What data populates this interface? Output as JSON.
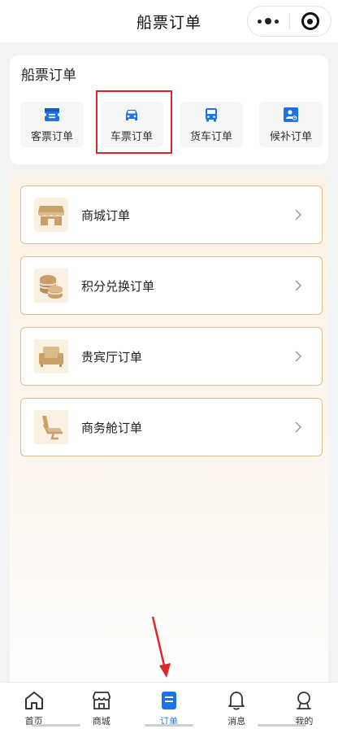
{
  "header": {
    "title": "船票订单"
  },
  "categories": {
    "title": "船票订单",
    "items": [
      {
        "label": "客票订单",
        "icon": "ticket-icon"
      },
      {
        "label": "车票订单",
        "icon": "car-icon"
      },
      {
        "label": "货车订单",
        "icon": "truck-icon"
      },
      {
        "label": "候补订单",
        "icon": "waitlist-icon"
      }
    ]
  },
  "orders": [
    {
      "label": "商城订单",
      "icon": "shop-icon"
    },
    {
      "label": "积分兑换订单",
      "icon": "coins-icon"
    },
    {
      "label": "贵宾厅订单",
      "icon": "sofa-icon"
    },
    {
      "label": "商务舱订单",
      "icon": "seat-icon"
    }
  ],
  "tabbar": {
    "items": [
      {
        "label": "首页",
        "icon": "home-icon"
      },
      {
        "label": "商城",
        "icon": "store-icon"
      },
      {
        "label": "订单",
        "icon": "order-icon"
      },
      {
        "label": "消息",
        "icon": "bell-icon"
      },
      {
        "label": "我的",
        "icon": "user-icon"
      }
    ],
    "active": "订单"
  },
  "colors": {
    "accent": "#1a73e8",
    "annotation": "#e0262b",
    "row_border": "#dcbd94",
    "gold_icon": "#c9a068"
  }
}
